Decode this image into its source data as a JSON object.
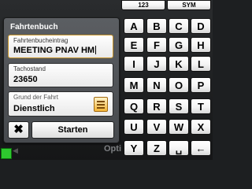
{
  "dialog": {
    "title": "Fahrtenbuch",
    "fields": [
      {
        "label": "Fahrtenbucheintrag",
        "value": "MEETING PNAV HM"
      },
      {
        "label": "Tachostand",
        "value": "23650"
      },
      {
        "label": "Grund der Fahrt",
        "value": "Dienstlich"
      }
    ],
    "cancel_label": "✖",
    "start_label": "Starten"
  },
  "keyboard": {
    "mode_keys": [
      "123",
      "SYM"
    ],
    "rows": [
      [
        "A",
        "B",
        "C",
        "D"
      ],
      [
        "E",
        "F",
        "G",
        "H"
      ],
      [
        "I",
        "J",
        "K",
        "L"
      ],
      [
        "M",
        "N",
        "O",
        "P"
      ],
      [
        "Q",
        "R",
        "S",
        "T"
      ],
      [
        "U",
        "V",
        "W",
        "X"
      ],
      [
        "Y",
        "Z",
        "␣",
        "←"
      ]
    ]
  },
  "background": {
    "bottom_text": "Opti"
  },
  "colors": {
    "dialog_bg": "#52555a",
    "active_border": "#c9962a",
    "list_button": "#f2b437",
    "status_green": "#2ec82e"
  },
  "icons": {
    "cancel": "close-icon",
    "grund_list": "list-icon",
    "space": "space-icon",
    "backspace": "backspace-icon"
  }
}
